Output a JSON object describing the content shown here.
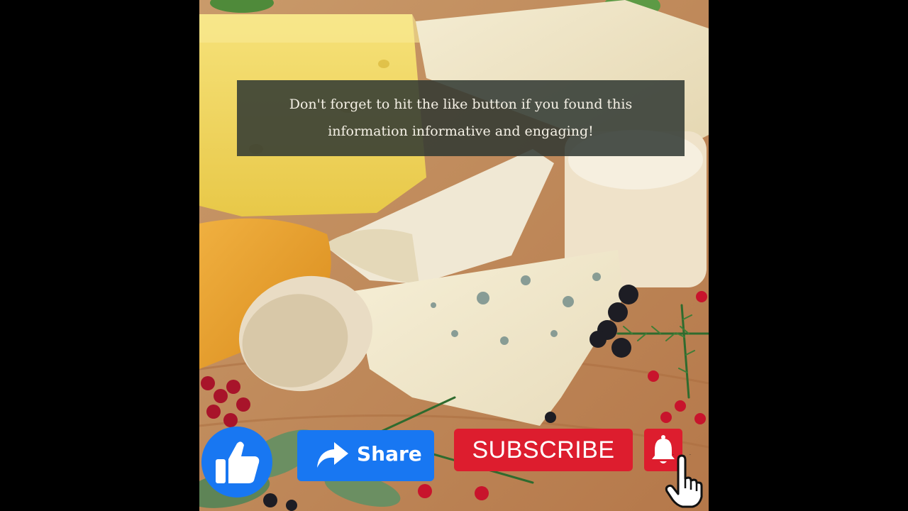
{
  "caption": {
    "line1": "Don't forget to hit the like button if you found this",
    "line2": "information informative and engaging!"
  },
  "buttons": {
    "like_icon": "thumbs-up-icon",
    "share_label": "Share",
    "share_icon": "share-arrow-icon",
    "subscribe_label": "SUBSCRIBE",
    "bell_icon": "bell-icon"
  },
  "colors": {
    "facebook_blue": "#1877f2",
    "subscribe_red": "#dd1d2e",
    "caption_bg": "#303832"
  }
}
